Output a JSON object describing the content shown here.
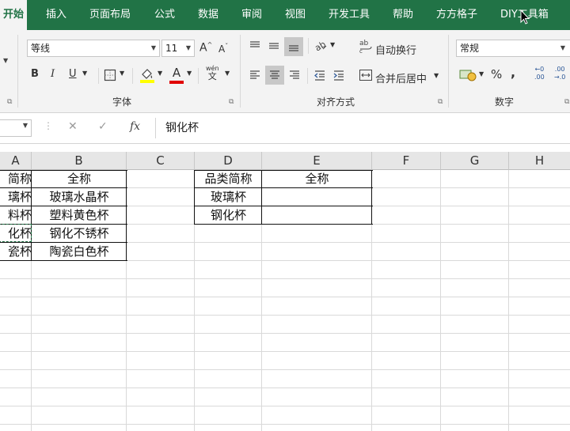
{
  "tabs": [
    "开始",
    "插入",
    "页面布局",
    "公式",
    "数据",
    "审阅",
    "视图",
    "开发工具",
    "帮助",
    "方方格子",
    "DIY工具箱"
  ],
  "ribbon": {
    "font_name": "等线",
    "font_size": "11",
    "grow_font": "A",
    "shrink_font": "A",
    "bold": "B",
    "italic": "I",
    "underline": "U",
    "phonetic_top": "wén",
    "phonetic_bottom": "文",
    "font_group": "字体",
    "wrap_text": "自动换行",
    "merge_center": "合并后居中",
    "align_group": "对齐方式",
    "number_format": "常规",
    "percent": "%",
    "comma": ",",
    "number_group": "数字",
    "increase_decimal": ".00",
    "decrease_decimal": "→.0"
  },
  "formula_bar": {
    "fx": "fx",
    "value": "钢化杯"
  },
  "columns": [
    "A",
    "B",
    "C",
    "D",
    "E",
    "F",
    "G",
    "H"
  ],
  "table1": {
    "header_a": "简称",
    "header_b": "全称",
    "rows": [
      {
        "a": "璃杯",
        "b": "玻璃水晶杯"
      },
      {
        "a": "料杯",
        "b": "塑料黄色杯"
      },
      {
        "a": "化杯",
        "b": "钢化不锈杯"
      },
      {
        "a": "瓷杯",
        "b": "陶瓷白色杯"
      }
    ]
  },
  "table2": {
    "header_d": "品类简称",
    "header_e": "全称",
    "rows": [
      {
        "d": "玻璃杯",
        "e": ""
      },
      {
        "d": "钢化杯",
        "e": ""
      }
    ]
  },
  "colors": {
    "excel_green": "#217346",
    "font_color_red": "#e00000",
    "highlight_yellow": "#ffff00"
  }
}
